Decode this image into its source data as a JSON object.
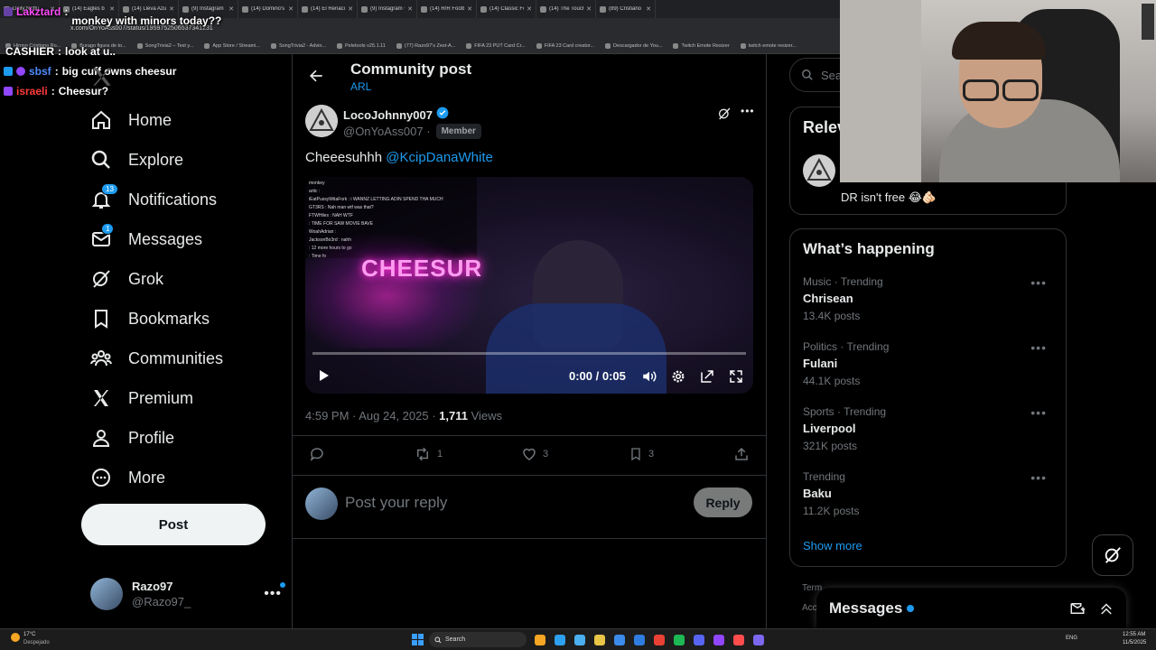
{
  "browser": {
    "tabs": [
      {
        "title": "Daily Nottu"
      },
      {
        "title": "(14) Eagles b"
      },
      {
        "title": "(14) Lleva Azulo"
      },
      {
        "title": "(9) Instagram"
      },
      {
        "title": "(14) Domino's Pi"
      },
      {
        "title": "(14) El Renacido"
      },
      {
        "title": "(9) Instagram • Il"
      },
      {
        "title": "(14) R/R Football"
      },
      {
        "title": "(14) Classic Foot"
      },
      {
        "title": "(14) The Touchli"
      },
      {
        "title": "(89) Cristiano Ro"
      }
    ],
    "url": "x.com/OnYoAss007/status/1959752506537341231",
    "bookmarks": [
      "Himno Cristiano Ro...",
      "Burago figura de to...",
      "SongTrivia2 – Test y...",
      "App Store / Streami...",
      "SongTrivia2 - Advin...",
      "Peletools v25.1.11",
      "(77) Razo97's Zest-A...",
      "FIFA 23 PUT Card Cr...",
      "FIFA 23 Card creator...",
      "Descargador de You...",
      "Twitch Emote Resizer",
      "twitch emote resizer..."
    ]
  },
  "chat": [
    {
      "user": "Lakztard",
      "message": "monkey with minors today??",
      "color": "#ff4dff"
    },
    {
      "user": "CASHIER",
      "message": "look at u..",
      "color": "#ffffff"
    },
    {
      "user": "sbsf",
      "message": "big cuff owns cheesur",
      "color": "#4f8cff"
    },
    {
      "user": "israeli",
      "message": "Cheesur?",
      "color": "#ff3b3b"
    }
  ],
  "sidebar": {
    "items": [
      {
        "label": "Home",
        "icon": "home-icon"
      },
      {
        "label": "Explore",
        "icon": "search-icon"
      },
      {
        "label": "Notifications",
        "icon": "bell-icon",
        "badge": "13"
      },
      {
        "label": "Messages",
        "icon": "mail-icon",
        "badge": "1"
      },
      {
        "label": "Grok",
        "icon": "grok-icon"
      },
      {
        "label": "Bookmarks",
        "icon": "bookmark-icon"
      },
      {
        "label": "Communities",
        "icon": "communities-icon"
      },
      {
        "label": "Premium",
        "icon": "x-logo-icon"
      },
      {
        "label": "Profile",
        "icon": "person-icon"
      },
      {
        "label": "More",
        "icon": "more-circle-icon"
      }
    ],
    "post_label": "Post",
    "account": {
      "name": "Razo97",
      "handle": "@Razo97_"
    }
  },
  "header": {
    "title": "Community post",
    "community": "ARL"
  },
  "post": {
    "author_name": "LocoJohnny007",
    "author_handle": "@OnYoAss007 ·",
    "role": "Member",
    "text": "Cheeesuhhh",
    "mention": "@KcipDanaWhite",
    "video": {
      "neon_sign": "CHEESUR",
      "time": "0:00 / 0:05",
      "progress": 0.0,
      "chat_overlay": [
        "monkey",
        "artic :",
        "iEatPussyWitaFork : i WANNZ LETTING ADIN SPEND THA MUCH",
        "GT3RS : Nah man wtf was that?",
        "FTWHiles : NAH WTF",
        ": TIME FOR SAW MOVIE BAVE",
        "WoahAdrian :",
        "JacksonBo3rd : nahh",
        ": 12 more hours to go",
        ": Time fo"
      ]
    },
    "timestamp": "4:59 PM · Aug 24, 2025 · ",
    "views_count": "1,711",
    "views_label": " Views",
    "actions": {
      "reply": "",
      "repost": "1",
      "like": "3",
      "bookmark": "3"
    }
  },
  "reply_box": {
    "placeholder": "Post your reply",
    "button": "Reply"
  },
  "right": {
    "search_placeholder": "Sear",
    "relevant_title": "Relev",
    "relevant_bio": "DR isn't free 😂🫵🏻",
    "whats_happening": "What’s happening",
    "trends": [
      {
        "category": "Music · Trending",
        "name": "Chrisean",
        "count": "13.4K posts"
      },
      {
        "category": "Politics · Trending",
        "name": "Fulani",
        "count": "44.1K posts"
      },
      {
        "category": "Sports · Trending",
        "name": "Liverpool",
        "count": "321K posts"
      },
      {
        "category": "Trending",
        "name": "Baku",
        "count": "11.2K posts"
      }
    ],
    "show_more": "Show more",
    "footer_partial_1": "Term",
    "footer_partial_2": "Acc"
  },
  "messages_drawer": {
    "title": "Messages"
  },
  "taskbar": {
    "weather_temp": "17°C",
    "weather_desc": "Despejado",
    "search": "Search",
    "lang": "ENG",
    "time": "12:55 AM",
    "date": "11/5/2025"
  },
  "colors": {
    "accent": "#1d9bf0",
    "background": "#000000",
    "border": "#2f3336",
    "muted": "#71767b",
    "neon": "#ff2bd6"
  }
}
